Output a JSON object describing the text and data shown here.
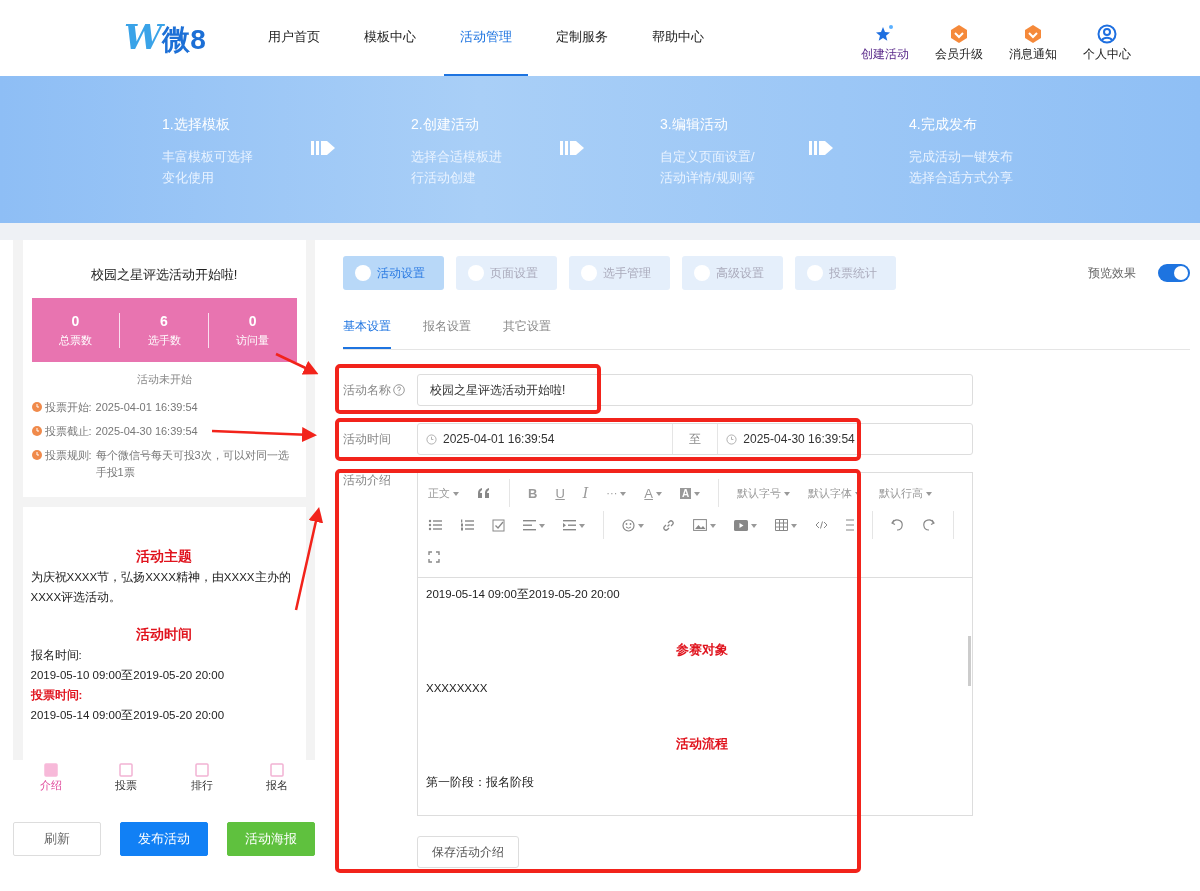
{
  "header": {
    "logo": {
      "mark": "W",
      "text": "微8"
    },
    "nav": [
      {
        "label": "用户首页",
        "selected": false
      },
      {
        "label": "模板中心",
        "selected": false
      },
      {
        "label": "活动管理",
        "selected": true
      },
      {
        "label": "定制服务",
        "selected": false
      },
      {
        "label": "帮助中心",
        "selected": false
      }
    ],
    "actions": [
      {
        "label": "创建活动",
        "kind": "create"
      },
      {
        "label": "会员升级",
        "kind": "badge"
      },
      {
        "label": "消息通知",
        "kind": "badge"
      },
      {
        "label": "个人中心",
        "kind": "user"
      }
    ]
  },
  "steps": [
    {
      "title": "1.选择模板",
      "lines": [
        "丰富模板可选择",
        "变化使用"
      ]
    },
    {
      "title": "2.创建活动",
      "lines": [
        "选择合适模板进",
        "行活动创建"
      ]
    },
    {
      "title": "3.编辑活动",
      "lines": [
        "自定义页面设置/",
        "活动详情/规则等"
      ]
    },
    {
      "title": "4.完成发布",
      "lines": [
        "完成活动一键发布",
        "选择合适方式分享"
      ]
    }
  ],
  "preview_phone": {
    "title": "校园之星评选活动开始啦!",
    "stats": [
      {
        "value": "0",
        "label": "总票数"
      },
      {
        "value": "6",
        "label": "选手数"
      },
      {
        "value": "0",
        "label": "访问量"
      }
    ],
    "status": "活动未开始",
    "info": [
      {
        "label": "投票开始:",
        "value": "2025-04-01 16:39:54"
      },
      {
        "label": "投票截止:",
        "value": "2025-04-30 16:39:54"
      },
      {
        "label": "投票规则:",
        "value": "每个微信号每天可投3次，可以对同一选手投1票"
      }
    ],
    "content": [
      {
        "kind": "heading",
        "text": "活动主题"
      },
      {
        "kind": "text",
        "text": "为庆祝XXXX节，弘扬XXXX精神，由XXXX主办的XXXX评选活动。"
      },
      {
        "kind": "heading",
        "text": "活动时间"
      },
      {
        "kind": "text",
        "text": "报名时间:"
      },
      {
        "kind": "text",
        "text": "2019-05-10 09:00至2019-05-20 20:00"
      },
      {
        "kind": "label",
        "text": "投票时间:"
      },
      {
        "kind": "text",
        "text": "2019-05-14 09:00至2019-05-20 20:00"
      }
    ],
    "bottom_nav": [
      {
        "label": "介绍",
        "selected": true
      },
      {
        "label": "投票",
        "selected": false
      },
      {
        "label": "排行",
        "selected": false
      },
      {
        "label": "报名",
        "selected": false
      }
    ],
    "buttons": [
      {
        "label": "刷新",
        "kind": "default"
      },
      {
        "label": "发布活动",
        "kind": "primary"
      },
      {
        "label": "活动海报",
        "kind": "success"
      }
    ]
  },
  "tabs": [
    {
      "label": "活动设置",
      "selected": true
    },
    {
      "label": "页面设置",
      "selected": false
    },
    {
      "label": "选手管理",
      "selected": false
    },
    {
      "label": "高级设置",
      "selected": false
    },
    {
      "label": "投票统计",
      "selected": false
    }
  ],
  "preview_toggle": {
    "label": "预览效果",
    "on": true
  },
  "sub_tabs": [
    {
      "label": "基本设置",
      "selected": true
    },
    {
      "label": "报名设置",
      "selected": false
    },
    {
      "label": "其它设置",
      "selected": false
    }
  ],
  "form": {
    "name": {
      "label": "活动名称",
      "value": "校园之星评选活动开始啦!"
    },
    "time": {
      "label": "活动时间",
      "start": "2025-04-01 16:39:54",
      "separator": "至",
      "end": "2025-04-30 16:39:54"
    },
    "intro": {
      "label": "活动介绍",
      "toolbar": {
        "format": "正文",
        "bold": "B",
        "underline": "U",
        "italic": "I",
        "more": "···",
        "font_color": "A",
        "bg_color": "A",
        "size": "默认字号",
        "family": "默认字体",
        "line_height": "默认行高"
      },
      "content": [
        {
          "kind": "text",
          "text": "2019-05-14 09:00至2019-05-20 20:00"
        },
        {
          "kind": "heading",
          "text": "参赛对象"
        },
        {
          "kind": "text",
          "text": "XXXXXXXX"
        },
        {
          "kind": "heading",
          "text": "活动流程"
        },
        {
          "kind": "text",
          "text": "第一阶段：报名阶段"
        }
      ],
      "save": "保存活动介绍"
    }
  }
}
